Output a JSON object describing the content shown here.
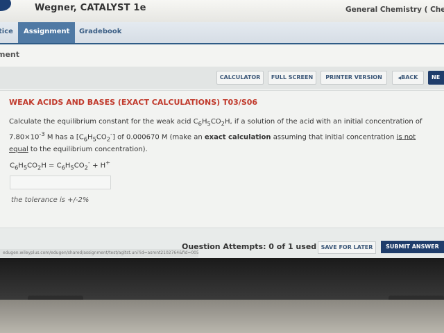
{
  "header": {
    "book_title": "Wegner, CATALYST 1e",
    "course_title": "General Chemistry ( Che"
  },
  "nav": {
    "tabs": [
      {
        "label": "tice"
      },
      {
        "label": "Assignment"
      },
      {
        "label": "Gradebook"
      }
    ]
  },
  "section": {
    "title": "ment"
  },
  "toolbar": {
    "calculator": "CALCULATOR",
    "full_screen": "FULL SCREEN",
    "printer_version": "PRINTER VERSION",
    "back": "BACK",
    "next": "NE"
  },
  "question": {
    "title": "WEAK ACIDS AND BASES (EXACT CALCULATIONS) T03/S06",
    "text_1": "Calculate the equilibrium constant for the weak acid C",
    "text_2": "H",
    "text_3": "CO",
    "text_4": "H, if a solution of the acid with an initial concentration of",
    "text_5": "7.80×10",
    "exp_neg3": "-3",
    "text_6": " M has a [C",
    "text_7": "H",
    "text_8": "CO",
    "text_9": "] of 0.000670 M (make an ",
    "bold_exact": "exact calculation",
    "text_10": " assuming that initial concentration ",
    "ul_is_not": "is not",
    "ul_equal": "equal",
    "text_11": " to the equilibrium concentration).",
    "sub_6": "6",
    "sub_5": "5",
    "sub_2": "2",
    "sup_minus": "-",
    "eq_c": "C",
    "eq_h": "H",
    "eq_co": "CO",
    "eq_h_end": "H = C",
    "eq_plus": " + H",
    "sup_plus": "+",
    "answer_value": "",
    "tolerance": "the tolerance is +/-2%"
  },
  "footer": {
    "attempts": "Question Attempts: 0 of 1 used",
    "save_label": "SAVE FOR LATER",
    "submit_label": "SUBMIT ANSWER",
    "status_url": "edugen.wileyplus.com/edugen/shared/assignment/test/agltst.uni?id=asmnt2102764&fid=0052"
  },
  "colors": {
    "accent": "#1f3d6b",
    "tab_active": "#4f79a4",
    "question_title": "#c0392b"
  },
  "icons": {
    "back_arrow": "triangle-left-icon",
    "logo": "logo-circle-icon"
  }
}
